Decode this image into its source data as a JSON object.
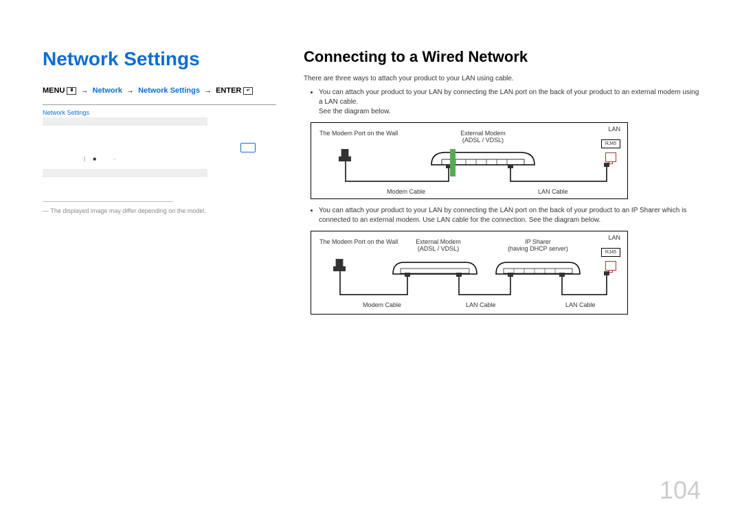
{
  "left": {
    "title": "Network Settings",
    "breadcrumb": {
      "menu": "MENU",
      "network": "Network",
      "network_settings": "Network Settings",
      "enter": "ENTER"
    },
    "screenshot_title": "Network Settings",
    "note": "The displayed image may differ depending on the model."
  },
  "right": {
    "subtitle": "Connecting to a Wired Network",
    "intro": "There are three ways to attach your product to your LAN using cable.",
    "bullet1": "You can attach your product to your LAN by connecting the LAN port on the back of your product to an external modem using a LAN cable.",
    "see1": "See the diagram below.",
    "bullet2": "You can attach your product to your LAN by connecting the LAN port on the back of your product to an IP Sharer which is connected to an external modem. Use LAN cable for the connection. See the diagram below.",
    "diagram1": {
      "wall_label": "The Modem Port on the Wall",
      "modem_label": "External Modem",
      "modem_sub": "(ADSL / VDSL)",
      "lan_label": "LAN",
      "rj45": "RJ45",
      "modem_cable": "Modem Cable",
      "lan_cable": "LAN Cable"
    },
    "diagram2": {
      "wall_label": "The Modem Port on the Wall",
      "modem_label": "External Modem",
      "modem_sub": "(ADSL / VDSL)",
      "sharer_label": "IP Sharer",
      "sharer_sub": "(having DHCP server)",
      "lan_label": "LAN",
      "rj45": "RJ45",
      "modem_cable": "Modem Cable",
      "lan_cable1": "LAN Cable",
      "lan_cable2": "LAN Cable"
    }
  },
  "page_number": "104"
}
